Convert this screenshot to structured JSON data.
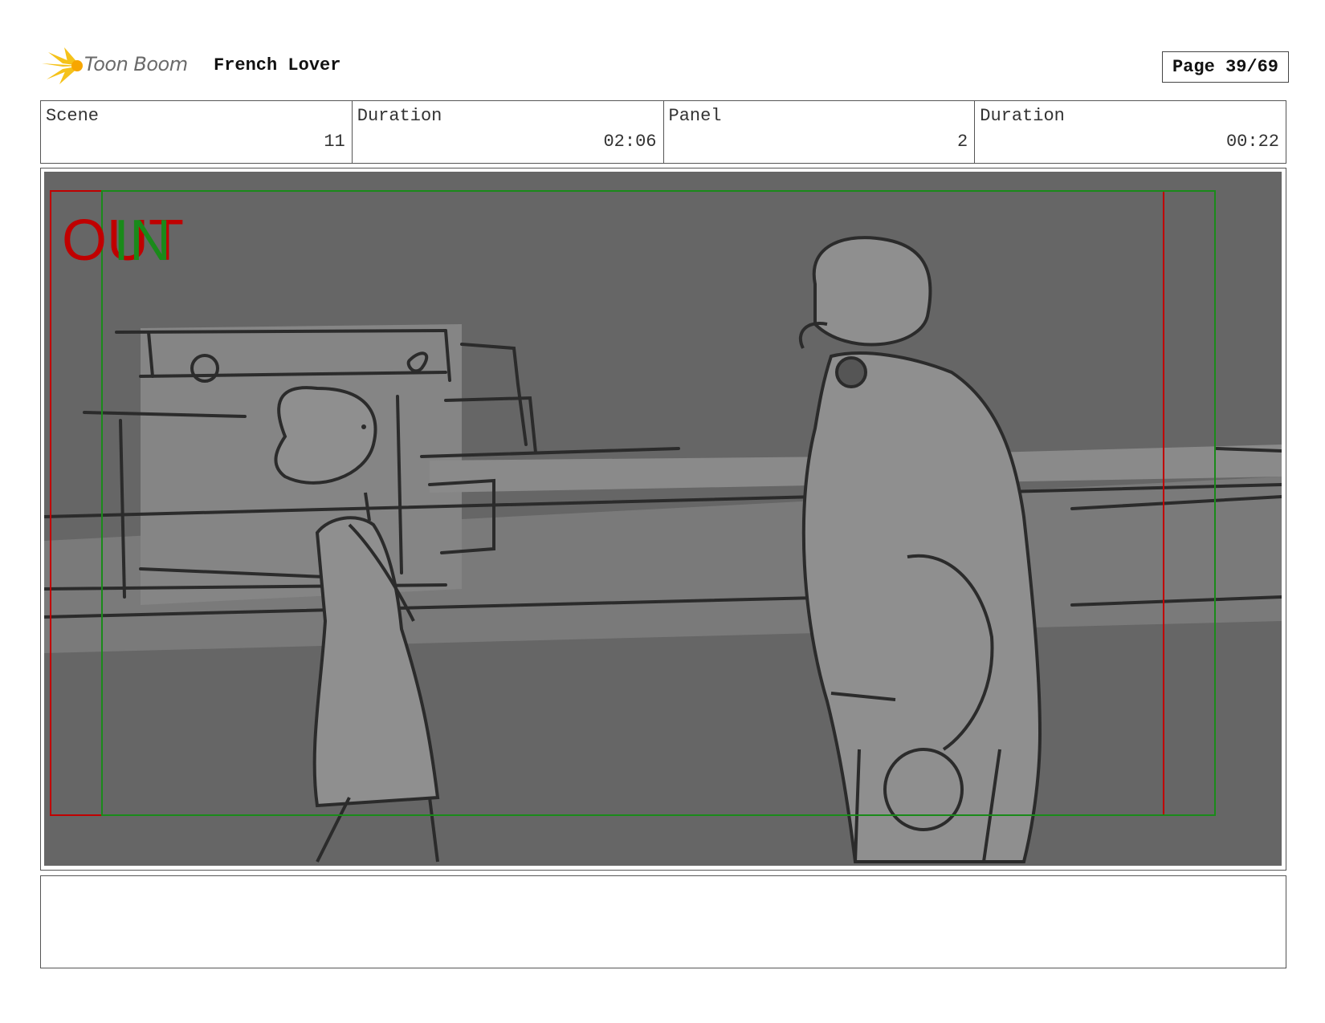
{
  "header": {
    "logo_text": "Toon Boom",
    "project_title": "French Lover",
    "page_label": "Page 39/69"
  },
  "info": [
    {
      "label": "Scene",
      "value": "11"
    },
    {
      "label": "Duration",
      "value": "02:06"
    },
    {
      "label": "Panel",
      "value": "2"
    },
    {
      "label": "Duration",
      "value": "00:22"
    }
  ],
  "panel": {
    "overlay_out_text": "OUT",
    "overlay_in_text": "IN",
    "colors": {
      "background": "#666666",
      "sketch_fill": "#8f8f8f",
      "wall_fill": "#7a7a7a",
      "line": "#2b2b2b",
      "out_frame": "#c00000",
      "in_frame": "#1a8a1a"
    }
  },
  "notes": {
    "text": ""
  }
}
